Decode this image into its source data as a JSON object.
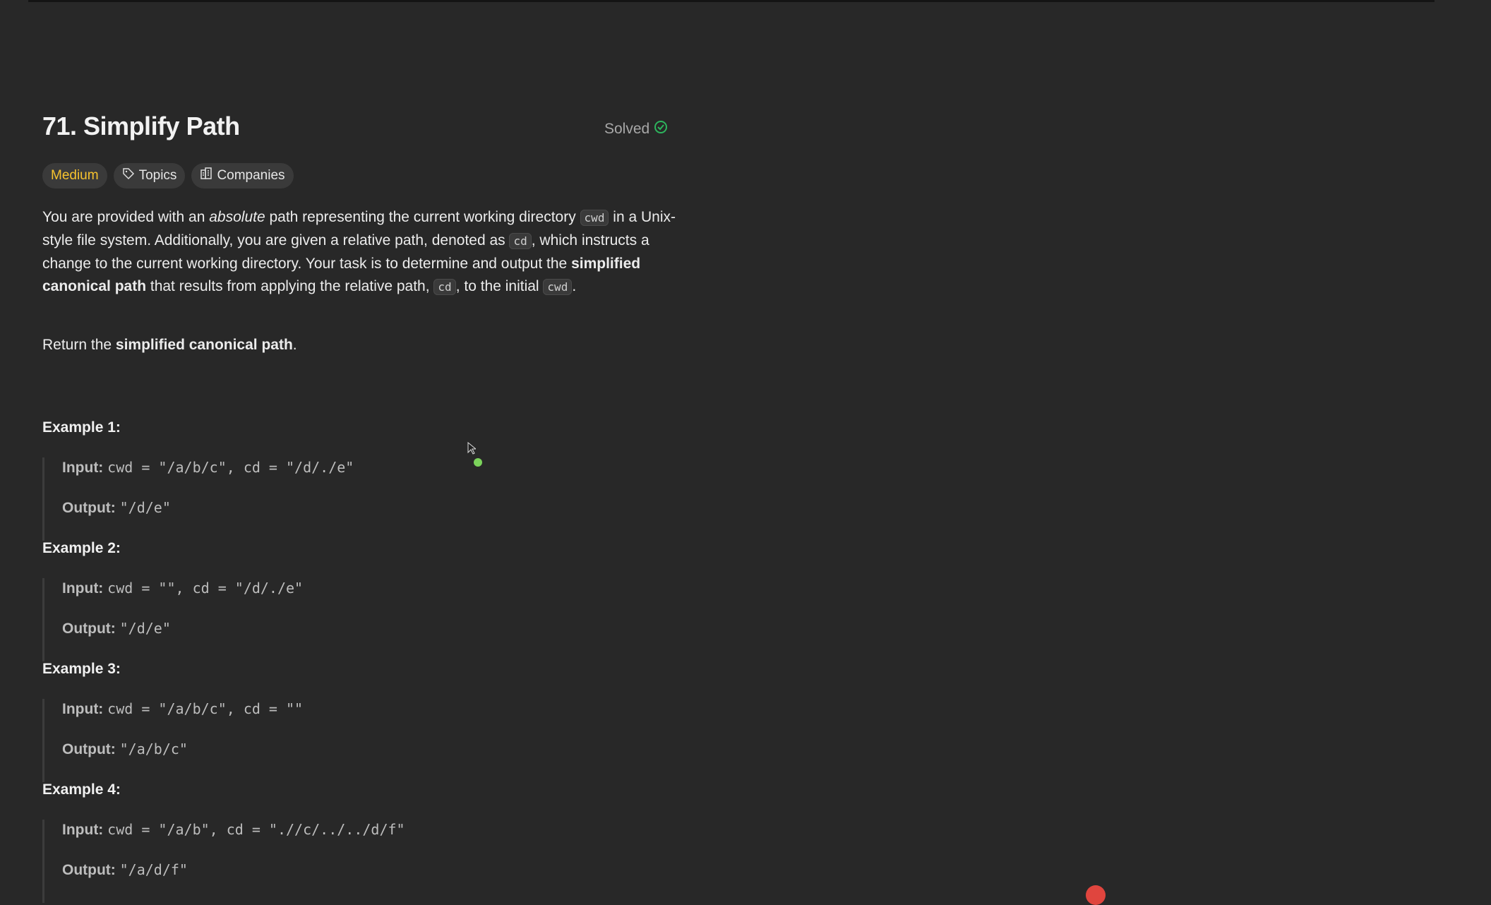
{
  "problem": {
    "title": "71. Simplify Path",
    "status": "Solved",
    "tags": {
      "difficulty": "Medium",
      "topics": "Topics",
      "companies": "Companies"
    },
    "description": {
      "t1": "You are provided with an ",
      "t2": "absolute",
      "t3": " path representing the current working directory ",
      "c1": "cwd",
      "t4": " in a Unix-style file system. Additionally, you are given a relative path, denoted as ",
      "c2": "cd",
      "t5": ", which instructs a change to the current working directory. Your task is to determine and output the ",
      "t6": "simplified canonical path",
      "t7": " that results from applying the relative path, ",
      "c3": "cd",
      "t8": ", to the initial ",
      "c4": "cwd",
      "t9": "."
    },
    "return": {
      "t1": "Return the ",
      "t2": "simplified canonical path",
      "t3": "."
    },
    "input_label": "Input:",
    "output_label": "Output:",
    "examples": [
      {
        "heading": "Example 1:",
        "input": "cwd = \"/a/b/c\", cd = \"/d/./e\"",
        "output": "\"/d/e\""
      },
      {
        "heading": "Example 2:",
        "input": "cwd = \"\", cd = \"/d/./e\"",
        "output": "\"/d/e\""
      },
      {
        "heading": "Example 3:",
        "input": "cwd = \"/a/b/c\", cd = \"\"",
        "output": "\"/a/b/c\""
      },
      {
        "heading": "Example 4:",
        "input": "cwd = \"/a/b\", cd = \".//c/../../d/f\"",
        "output": "\"/a/d/f\""
      }
    ]
  },
  "colors": {
    "difficulty_medium": "#f7c32e",
    "solved_check": "#2db55d",
    "background": "#282828"
  }
}
